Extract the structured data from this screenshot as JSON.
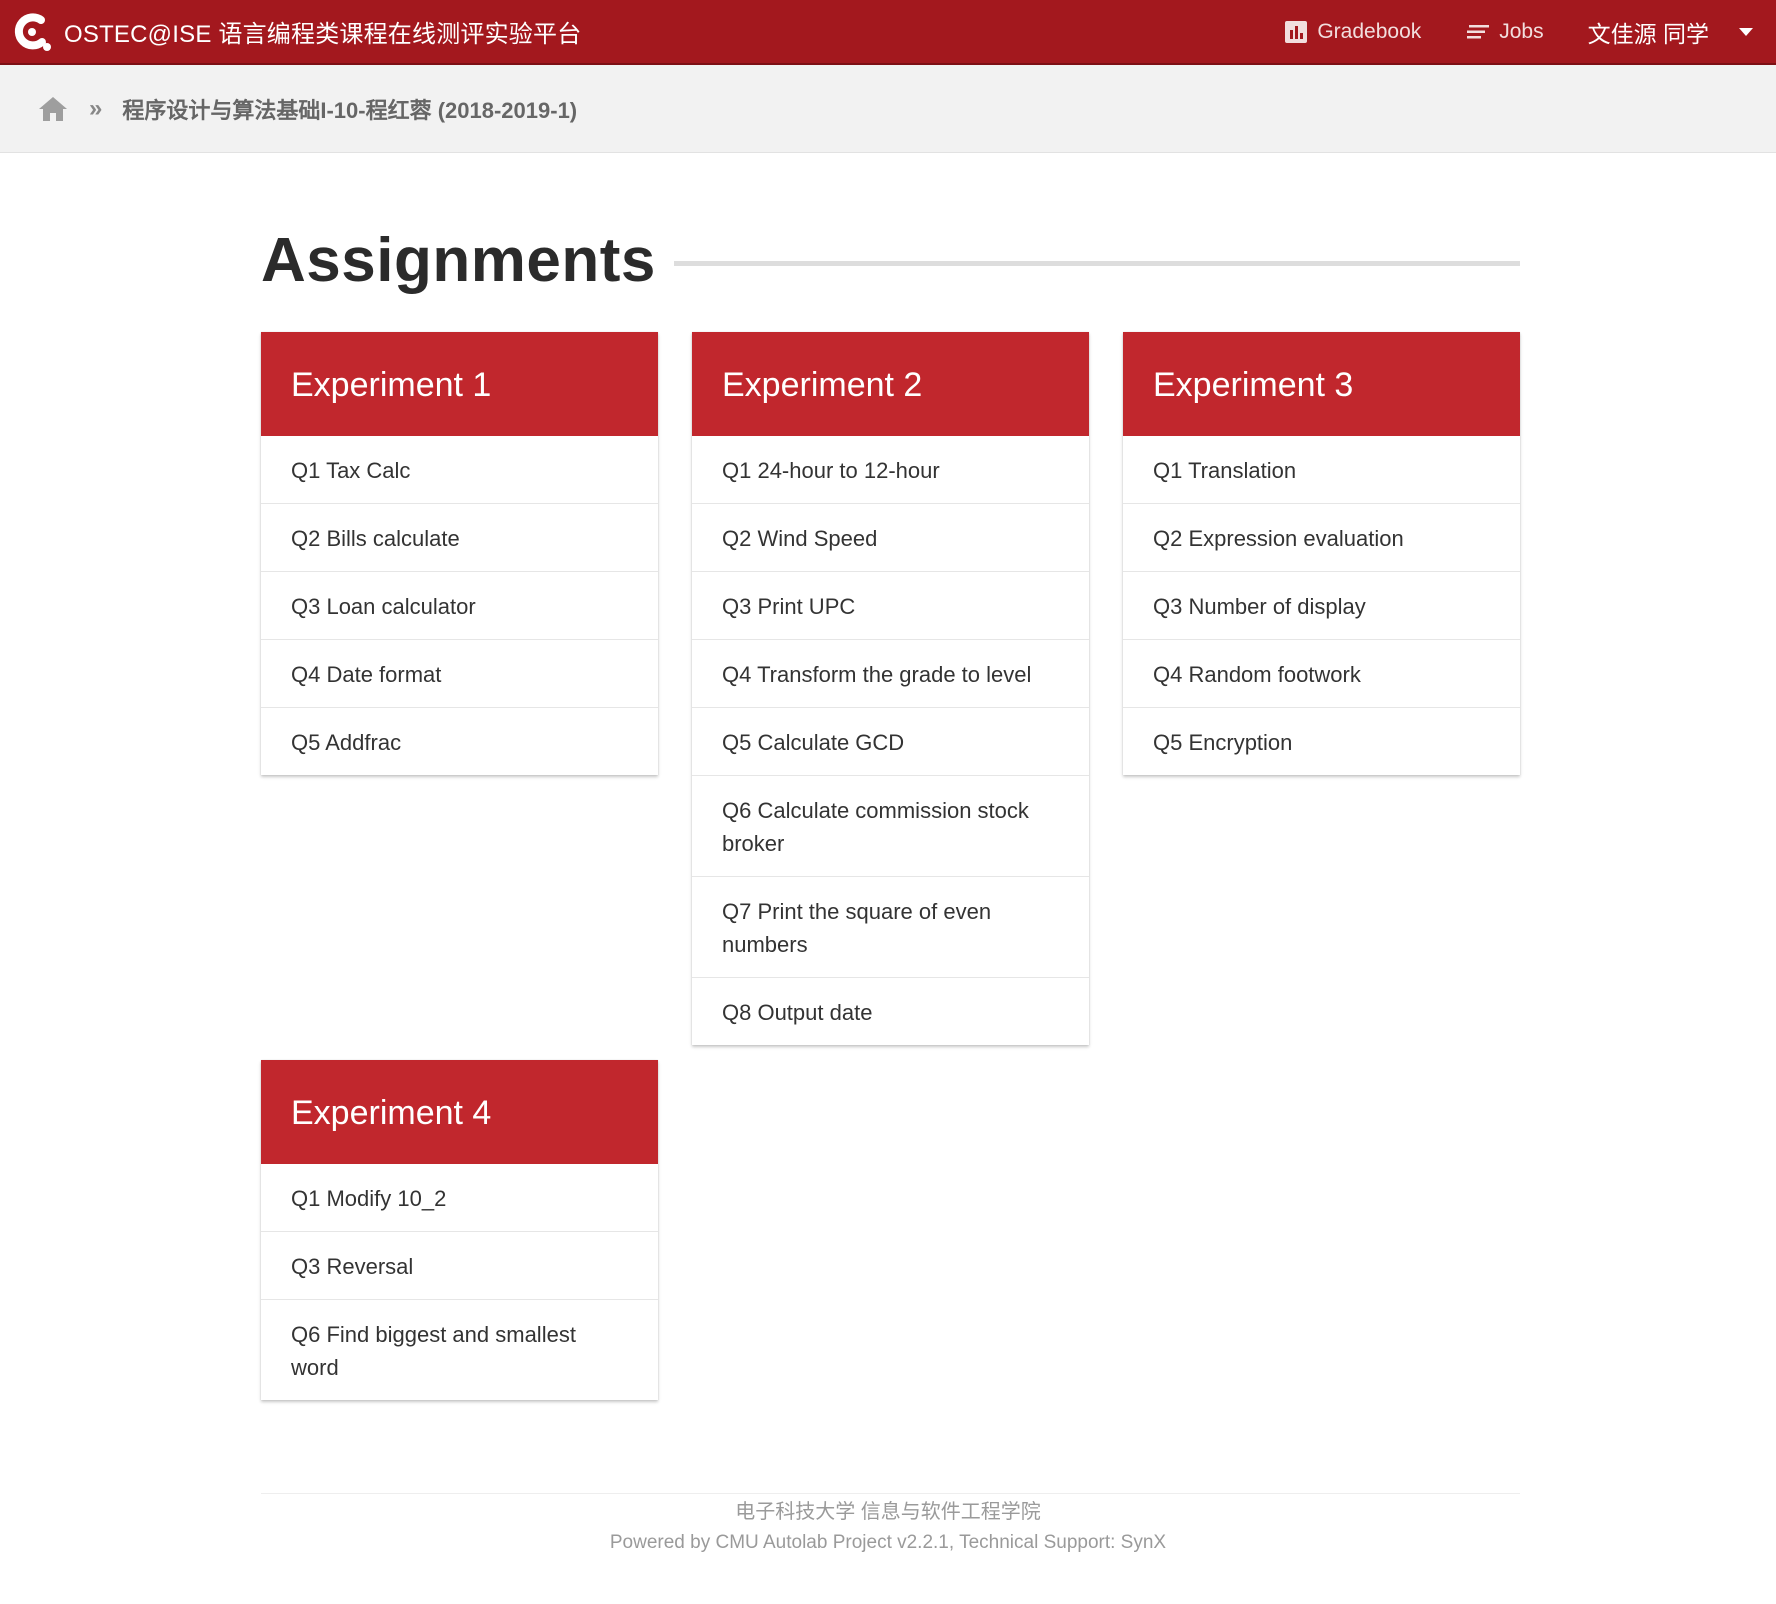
{
  "nav": {
    "brand_text": "OSTEC@ISE 语言编程类课程在线测评实验平台",
    "gradebook_label": "Gradebook",
    "jobs_label": "Jobs",
    "user_name": "文佳源 同学",
    "colors": {
      "nav_bg": "#a3181e",
      "accent": "#c1272d"
    }
  },
  "breadcrumb": {
    "course": "程序设计与算法基础I-10-程红蓉 (2018-2019-1)"
  },
  "page_title": "Assignments",
  "categories": [
    {
      "name": "Experiment 1",
      "items": [
        "Q1 Tax Calc",
        "Q2 Bills calculate",
        "Q3 Loan calculator",
        "Q4 Date format",
        "Q5 Addfrac"
      ]
    },
    {
      "name": "Experiment 2",
      "items": [
        "Q1 24-hour to 12-hour",
        "Q2 Wind Speed",
        "Q3 Print UPC",
        "Q4 Transform the grade to level",
        "Q5 Calculate GCD",
        "Q6 Calculate commission stock broker",
        "Q7 Print the square of even numbers",
        "Q8 Output date"
      ]
    },
    {
      "name": "Experiment 3",
      "items": [
        "Q1 Translation",
        "Q2 Expression evaluation",
        "Q3 Number of display",
        "Q4 Random footwork",
        "Q5 Encryption"
      ]
    },
    {
      "name": "Experiment 4",
      "items": [
        "Q1 Modify 10_2",
        "Q3 Reversal",
        "Q6 Find biggest and smallest word"
      ]
    }
  ],
  "footer": {
    "line1": "电子科技大学 信息与软件工程学院",
    "line2": "Powered by CMU Autolab Project v2.2.1, Technical Support: SynX"
  }
}
